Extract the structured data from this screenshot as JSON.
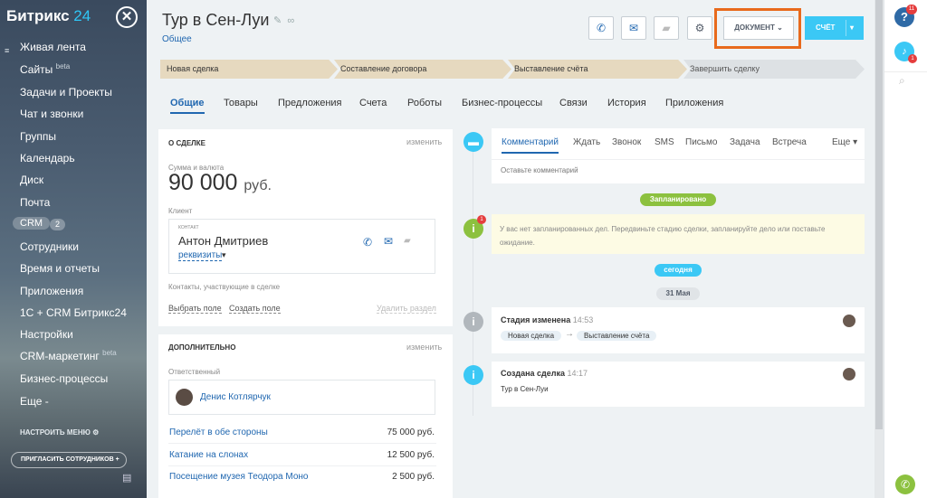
{
  "sidebar": {
    "logo_main": "Битрикс",
    "logo_num": " 24",
    "close_glyph": "✕",
    "menu_icon": "≡",
    "items": [
      {
        "label": "Живая лента"
      },
      {
        "label": "Сайты",
        "badge": "beta"
      },
      {
        "label": "Задачи и Проекты"
      },
      {
        "label": "Чат и звонки"
      },
      {
        "label": "Группы"
      },
      {
        "label": "Календарь"
      },
      {
        "label": "Диск"
      },
      {
        "label": "Почта"
      },
      {
        "label": "CRM",
        "count": "2"
      },
      {
        "label": "Сотрудники"
      },
      {
        "label": "Время и отчеты"
      },
      {
        "label": "Приложения"
      },
      {
        "label": "1С + CRM Битрикс24"
      },
      {
        "label": "Настройки"
      },
      {
        "label": "CRM-маркетинг",
        "badge": "beta"
      },
      {
        "label": "Бизнес-процессы"
      },
      {
        "label": "Еще -"
      }
    ],
    "settings_menu": "НАСТРОИТЬ МЕНЮ",
    "invite": "ПРИГЛАСИТЬ СОТРУДНИКОВ +"
  },
  "header": {
    "title": "Тур в Сен-Луи",
    "subtitle": "Общее",
    "document_button": "ДОКУМЕНТ",
    "bill_button": "СЧЁТ"
  },
  "stages": [
    "Новая сделка",
    "Составление договора",
    "Выставление счёта",
    "Завершить сделку"
  ],
  "tabs": [
    "Общие",
    "Товары",
    "Предложения",
    "Счета",
    "Роботы",
    "Бизнес-процессы",
    "Связи",
    "История",
    "Приложения"
  ],
  "deal": {
    "heading": "О СДЕЛКЕ",
    "edit": "изменить",
    "amount_label": "Сумма и валюта",
    "amount": "90 000",
    "currency": "руб.",
    "client_label": "Клиент",
    "contact_tag": "КОНТАКТ",
    "contact_name": "Антон Дмитриев",
    "requisites": "реквизиты",
    "contacts_label": "Контакты, участвующие в сделке",
    "select_field": "Выбрать поле",
    "create_field": "Создать поле",
    "delete_section": "Удалить раздел"
  },
  "extra": {
    "heading": "ДОПОЛНИТЕЛЬНО",
    "edit": "изменить",
    "responsible_label": "Ответственный",
    "responsible": "Денис Котлярчук",
    "products": [
      {
        "name": "Перелёт в обе стороны",
        "price": "75 000 руб."
      },
      {
        "name": "Катание на слонах",
        "price": "12 500 руб."
      },
      {
        "name": "Посещение музея Теодора Моно",
        "price": "2 500 руб."
      }
    ]
  },
  "activity": {
    "tabs": [
      "Комментарий",
      "Ждать",
      "Звонок",
      "SMS",
      "Письмо",
      "Задача",
      "Встреча",
      "Еще"
    ],
    "comment_placeholder": "Оставьте комментарий",
    "planned_pill": "Запланировано",
    "planned_text": "У вас нет запланированных дел. Передвиньте стадию сделки, запланируйте дело или поставьте ожидание.",
    "warn_count": "1",
    "today_pill": "сегодня",
    "date_pill": "31 Мая",
    "events": [
      {
        "title": "Стадия изменена",
        "time": "14:53",
        "from": "Новая сделка",
        "to": "Выставление счёта"
      },
      {
        "title": "Создана сделка",
        "time": "14:17",
        "text": "Тур в Сен-Луи"
      }
    ]
  },
  "rail": {
    "help_count": "11",
    "bell_count": "1"
  },
  "colors": {
    "accent": "#2067b0",
    "bill": "#3bc8f5",
    "highlight": "#e86a1c",
    "stage": "#e6d9bf",
    "planned": "#8cc13f",
    "today": "#3bc8f5"
  }
}
